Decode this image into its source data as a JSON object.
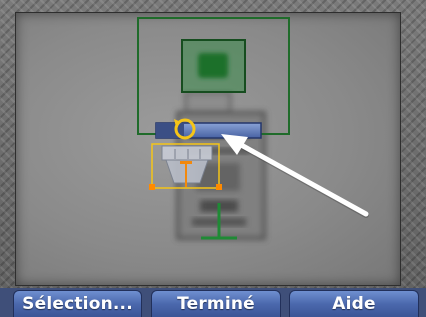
{
  "softkeys": {
    "select_label": "Sélection...",
    "done_label": "Terminé",
    "help_label": "Aide"
  },
  "colors": {
    "softkey_top": "#6f8fd0",
    "softkey_bottom": "#3b5596",
    "selection_green": "#1f6b2a",
    "handle_orange": "#ff8a00",
    "rotate_yellow": "#f5c518",
    "pointer_white": "#ffffff"
  },
  "icons": {
    "rotate": "rotate-icon",
    "pointer": "arrow-pointer-icon"
  }
}
